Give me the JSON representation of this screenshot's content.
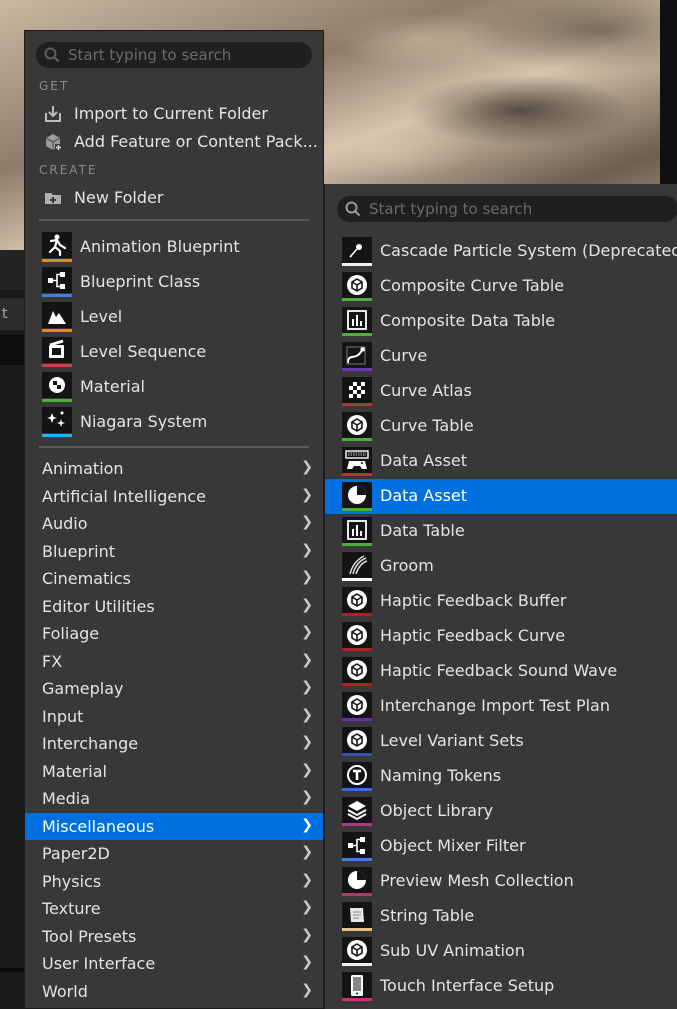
{
  "menu": {
    "search_placeholder": "Start typing to search",
    "get_header": "GET",
    "get_items": [
      {
        "label": "Import to Current Folder",
        "icon": "import-icon"
      },
      {
        "label": "Add Feature or Content Pack...",
        "icon": "feature-pack-icon"
      }
    ],
    "create_header": "CREATE",
    "new_folder_label": "New Folder",
    "assets": [
      {
        "label": "Animation Blueprint",
        "icon": "animation-blueprint-icon",
        "color": "#e08a1e"
      },
      {
        "label": "Blueprint Class",
        "icon": "blueprint-class-icon",
        "color": "#3f7fe0"
      },
      {
        "label": "Level",
        "icon": "level-icon",
        "color": "#e08a1e"
      },
      {
        "label": "Level Sequence",
        "icon": "level-sequence-icon",
        "color": "#c8424a"
      },
      {
        "label": "Material",
        "icon": "material-icon",
        "color": "#4fae3a"
      },
      {
        "label": "Niagara System",
        "icon": "niagara-system-icon",
        "color": "#21b6e8"
      }
    ],
    "categories": [
      "Animation",
      "Artificial Intelligence",
      "Audio",
      "Blueprint",
      "Cinematics",
      "Editor Utilities",
      "Foliage",
      "FX",
      "Gameplay",
      "Input",
      "Interchange",
      "Material",
      "Media",
      "Miscellaneous",
      "Paper2D",
      "Physics",
      "Texture",
      "Tool Presets",
      "User Interface",
      "World"
    ],
    "selected_category": "Miscellaneous"
  },
  "submenu": {
    "search_placeholder": "Start typing to search",
    "selected_item": "Data Asset",
    "items": [
      {
        "label": "Cascade Particle System (Deprecated)",
        "icon": "particle-icon",
        "color": "#eeeeee"
      },
      {
        "label": "Composite Curve Table",
        "icon": "cube-icon",
        "color": "#4fae3a"
      },
      {
        "label": "Composite Data Table",
        "icon": "chart-icon",
        "color": "#4fae3a"
      },
      {
        "label": "Curve",
        "icon": "curve-icon",
        "color": "#6a3ab0"
      },
      {
        "label": "Curve Atlas",
        "icon": "checker-icon",
        "color": "#a83a3a"
      },
      {
        "label": "Curve Table",
        "icon": "cube-icon",
        "color": "#4fae3a"
      },
      {
        "label": "Data Asset",
        "icon": "gamepad-icon",
        "color": "#a83a3a"
      },
      {
        "label": "Data Asset",
        "icon": "pie-icon",
        "color": "#4fae3a"
      },
      {
        "label": "Data Table",
        "icon": "chart-icon",
        "color": "#4fae3a"
      },
      {
        "label": "Groom",
        "icon": "groom-icon",
        "color": "#ffffff"
      },
      {
        "label": "Haptic Feedback Buffer",
        "icon": "cube-icon",
        "color": "#b02020"
      },
      {
        "label": "Haptic Feedback Curve",
        "icon": "cube-icon",
        "color": "#b02020"
      },
      {
        "label": "Haptic Feedback Sound Wave",
        "icon": "cube-icon",
        "color": "#b02020"
      },
      {
        "label": "Interchange Import Test Plan",
        "icon": "cube-icon",
        "color": "#6a2ab0"
      },
      {
        "label": "Level Variant Sets",
        "icon": "cube-icon",
        "color": "#3a4fb0"
      },
      {
        "label": "Naming Tokens",
        "icon": "token-icon",
        "color": "#3a6ae0"
      },
      {
        "label": "Object Library",
        "icon": "layers-icon",
        "color": "#b03a8a"
      },
      {
        "label": "Object Mixer Filter",
        "icon": "blueprint-class-icon",
        "color": "#3f7fe0"
      },
      {
        "label": "Preview Mesh Collection",
        "icon": "pie-icon",
        "color": "#b03a6a"
      },
      {
        "label": "String Table",
        "icon": "scroll-icon",
        "color": "#e8c08a"
      },
      {
        "label": "Sub UV Animation",
        "icon": "cube-icon",
        "color": "#eeeeee"
      },
      {
        "label": "Touch Interface Setup",
        "icon": "phone-icon",
        "color": "#d0307a"
      }
    ]
  },
  "background": {
    "tab_text": "t"
  }
}
